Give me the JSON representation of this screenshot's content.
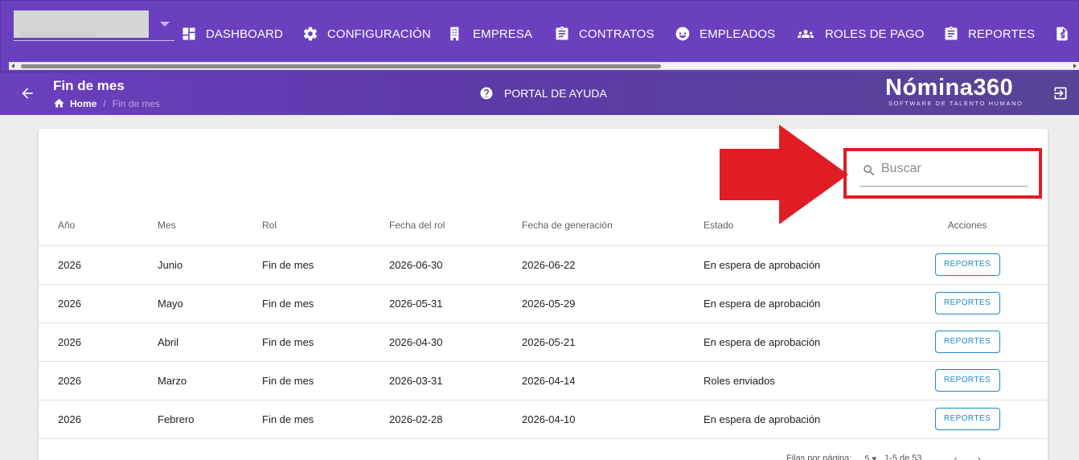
{
  "topnav": {
    "items": [
      {
        "label": "DASHBOARD",
        "icon": "dashboard-icon"
      },
      {
        "label": "CONFIGURACIÓN",
        "icon": "gear-icon"
      },
      {
        "label": "EMPRESA",
        "icon": "building-icon"
      },
      {
        "label": "CONTRATOS",
        "icon": "clipboard-icon"
      },
      {
        "label": "EMPLEADOS",
        "icon": "face-icon"
      },
      {
        "label": "ROLES DE PAGO",
        "icon": "group-icon"
      },
      {
        "label": "REPORTES",
        "icon": "clipboard-icon"
      }
    ]
  },
  "subbar": {
    "title": "Fin de mes",
    "breadcrumb": {
      "home": "Home",
      "current": "Fin de mes"
    },
    "help": "PORTAL DE AYUDA",
    "logo": {
      "name": "Nómina360",
      "tagline": "SOFTWARE DE TALENTO HUMANO"
    }
  },
  "search": {
    "placeholder": "Buscar"
  },
  "table": {
    "headers": [
      "Año",
      "Mes",
      "Rol",
      "Fecha del rol",
      "Fecha de generación",
      "Estado",
      "Acciones"
    ],
    "rows": [
      [
        "2026",
        "Junio",
        "Fin de mes",
        "2026-06-30",
        "2026-06-22",
        "En espera de aprobación",
        "REPORTES"
      ],
      [
        "2026",
        "Mayo",
        "Fin de mes",
        "2026-05-31",
        "2026-05-29",
        "En espera de aprobación",
        "REPORTES"
      ],
      [
        "2026",
        "Abril",
        "Fin de mes",
        "2026-04-30",
        "2026-05-21",
        "En espera de aprobación",
        "REPORTES"
      ],
      [
        "2026",
        "Marzo",
        "Fin de mes",
        "2026-03-31",
        "2026-04-14",
        "Roles enviados",
        "REPORTES"
      ],
      [
        "2026",
        "Febrero",
        "Fin de mes",
        "2026-02-28",
        "2026-04-10",
        "En espera de aprobación",
        "REPORTES"
      ]
    ]
  },
  "pagination": {
    "rows_per_page_label": "Filas por página:",
    "rows_per_page": "5",
    "range": "1-5 de 53"
  },
  "colors": {
    "nav": "#6a40bf",
    "highlight": "#e01d25",
    "link": "#1e88c7"
  }
}
